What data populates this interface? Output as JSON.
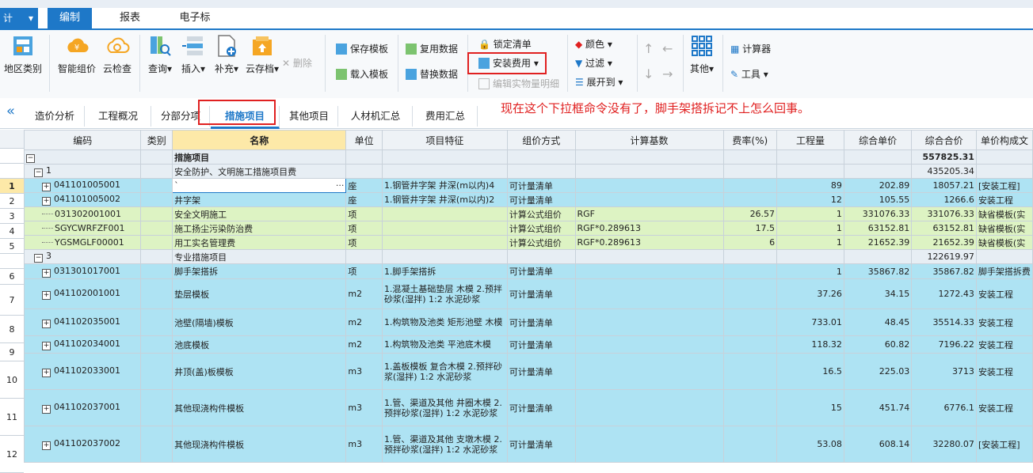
{
  "app": {
    "button_label": "计",
    "menu_tabs": [
      "编制",
      "报表",
      "电子标"
    ],
    "active_menu": "编制"
  },
  "ribbon": {
    "big_buttons": [
      "地区类别",
      "智能组价",
      "云检查",
      "查询",
      "插入",
      "补充",
      "云存档"
    ],
    "delete_label": "删除",
    "template_items": [
      "保存模板",
      "载入模板"
    ],
    "data_items": [
      "复用数据",
      "替换数据"
    ],
    "lock_list": "锁定清单",
    "install_fee": "安装费用",
    "edit_entity": "编辑实物量明细",
    "color": "颜色",
    "filter": "过滤",
    "expand_to": "展开到",
    "other": "其他",
    "calculator": "计算器",
    "tools": "工具"
  },
  "view_tabs": [
    "造价分析",
    "工程概况",
    "分部分项",
    "措施项目",
    "其他项目",
    "人材机汇总",
    "费用汇总"
  ],
  "active_view_tab": "措施项目",
  "annotation": "现在这个下拉框命令没有了，脚手架搭拆记不上怎么回事。",
  "table": {
    "columns": [
      "编码",
      "类别",
      "名称",
      "单位",
      "项目特征",
      "组价方式",
      "计算基数",
      "费率(%)",
      "工程量",
      "综合单价",
      "综合合价",
      "单价构成文"
    ],
    "rows": [
      {
        "num": "",
        "type": "head",
        "exp": "−",
        "code": "",
        "cat": "",
        "name": "措施项目",
        "unit": "",
        "feat": "",
        "method": "",
        "base": "",
        "rate": "",
        "qty": "",
        "price": "",
        "total": "557825.31",
        "comp": ""
      },
      {
        "num": "",
        "type": "head",
        "exp": "−",
        "code": "1",
        "cat": "",
        "name": "安全防护、文明施工措施项目费",
        "unit": "",
        "feat": "",
        "method": "",
        "base": "",
        "rate": "",
        "qty": "",
        "price": "",
        "total": "435205.34",
        "comp": ""
      },
      {
        "num": "1",
        "type": "blue",
        "exp": "+",
        "code": "041101005001",
        "cat": "",
        "name": "`",
        "unit": "座",
        "feat": "1.钢管井字架 井深(m以内)4",
        "method": "可计量清单",
        "base": "",
        "rate": "",
        "qty": "89",
        "price": "202.89",
        "total": "18057.21",
        "comp": "[安装工程]"
      },
      {
        "num": "2",
        "type": "blue",
        "exp": "+",
        "code": "041101005002",
        "cat": "",
        "name": "井字架",
        "unit": "座",
        "feat": "1.钢管井字架 井深(m以内)2",
        "method": "可计量清单",
        "base": "",
        "rate": "",
        "qty": "12",
        "price": "105.55",
        "total": "1266.6",
        "comp": "安装工程"
      },
      {
        "num": "3",
        "type": "green",
        "exp": "",
        "code": "031302001001",
        "cat": "",
        "name": "安全文明施工",
        "unit": "项",
        "feat": "",
        "method": "计算公式组价",
        "base": "RGF",
        "rate": "26.57",
        "qty": "1",
        "price": "331076.33",
        "total": "331076.33",
        "comp": "缺省模板(实"
      },
      {
        "num": "4",
        "type": "green",
        "exp": "",
        "code": "SGYCWRFZF001",
        "cat": "",
        "name": "施工扬尘污染防治费",
        "unit": "项",
        "feat": "",
        "method": "计算公式组价",
        "base": "RGF*0.289613",
        "rate": "17.5",
        "qty": "1",
        "price": "63152.81",
        "total": "63152.81",
        "comp": "缺省模板(实"
      },
      {
        "num": "5",
        "type": "green",
        "exp": "",
        "code": "YGSMGLF00001",
        "cat": "",
        "name": "用工实名管理费",
        "unit": "项",
        "feat": "",
        "method": "计算公式组价",
        "base": "RGF*0.289613",
        "rate": "6",
        "qty": "1",
        "price": "21652.39",
        "total": "21652.39",
        "comp": "缺省模板(实"
      },
      {
        "num": "",
        "type": "head",
        "exp": "−",
        "code": "3",
        "cat": "",
        "name": "专业措施项目",
        "unit": "",
        "feat": "",
        "method": "",
        "base": "",
        "rate": "",
        "qty": "",
        "price": "",
        "total": "122619.97",
        "comp": ""
      },
      {
        "num": "6",
        "type": "blue",
        "exp": "+",
        "code": "031301017001",
        "cat": "",
        "name": "脚手架搭拆",
        "unit": "项",
        "feat": "1.脚手架搭拆",
        "method": "可计量清单",
        "base": "",
        "rate": "",
        "qty": "1",
        "price": "35867.82",
        "total": "35867.82",
        "comp": "脚手架搭拆费"
      },
      {
        "num": "7",
        "type": "blue",
        "exp": "+",
        "code": "041102001001",
        "cat": "",
        "name": "垫层模板",
        "unit": "m2",
        "feat": "1.混凝土基础垫层 木模 2.预拌砂浆(湿拌) 1:2 水泥砂浆",
        "method": "可计量清单",
        "base": "",
        "rate": "",
        "qty": "37.26",
        "price": "34.15",
        "total": "1272.43",
        "comp": "安装工程"
      },
      {
        "num": "8",
        "type": "blue",
        "exp": "+",
        "code": "041102035001",
        "cat": "",
        "name": "池壁(隔墙)模板",
        "unit": "m2",
        "feat": "1.构筑物及池类 矩形池壁 木模",
        "method": "可计量清单",
        "base": "",
        "rate": "",
        "qty": "733.01",
        "price": "48.45",
        "total": "35514.33",
        "comp": "安装工程"
      },
      {
        "num": "9",
        "type": "blue",
        "exp": "+",
        "code": "041102034001",
        "cat": "",
        "name": "池底模板",
        "unit": "m2",
        "feat": "1.构筑物及池类 平池底木模",
        "method": "可计量清单",
        "base": "",
        "rate": "",
        "qty": "118.32",
        "price": "60.82",
        "total": "7196.22",
        "comp": "安装工程"
      },
      {
        "num": "10",
        "type": "blue",
        "exp": "+",
        "code": "041102033001",
        "cat": "",
        "name": "井顶(盖)板模板",
        "unit": "m3",
        "feat": "1.盖板模板 复合木模 2.预拌砂浆(湿拌) 1:2 水泥砂浆",
        "method": "可计量清单",
        "base": "",
        "rate": "",
        "qty": "16.5",
        "price": "225.03",
        "total": "3713",
        "comp": "安装工程"
      },
      {
        "num": "11",
        "type": "blue",
        "exp": "+",
        "code": "041102037001",
        "cat": "",
        "name": "其他现浇构件模板",
        "unit": "m3",
        "feat": "1.管、渠道及其他 井圈木模 2.预拌砂浆(湿拌) 1:2 水泥砂浆",
        "method": "可计量清单",
        "base": "",
        "rate": "",
        "qty": "15",
        "price": "451.74",
        "total": "6776.1",
        "comp": "安装工程"
      },
      {
        "num": "12",
        "type": "blue",
        "exp": "+",
        "code": "041102037002",
        "cat": "",
        "name": "其他现浇构件模板",
        "unit": "m3",
        "feat": "1.管、渠道及其他 支墩木模 2.预拌砂浆(湿拌) 1:2 水泥砂浆",
        "method": "可计量清单",
        "base": "",
        "rate": "",
        "qty": "53.08",
        "price": "608.14",
        "total": "32280.07",
        "comp": "[安装工程]"
      }
    ]
  },
  "colors": {
    "accent": "#1e78c8",
    "row_blue": "#aee3f3",
    "row_green": "#ddf3c3",
    "highlight": "#e02020"
  }
}
